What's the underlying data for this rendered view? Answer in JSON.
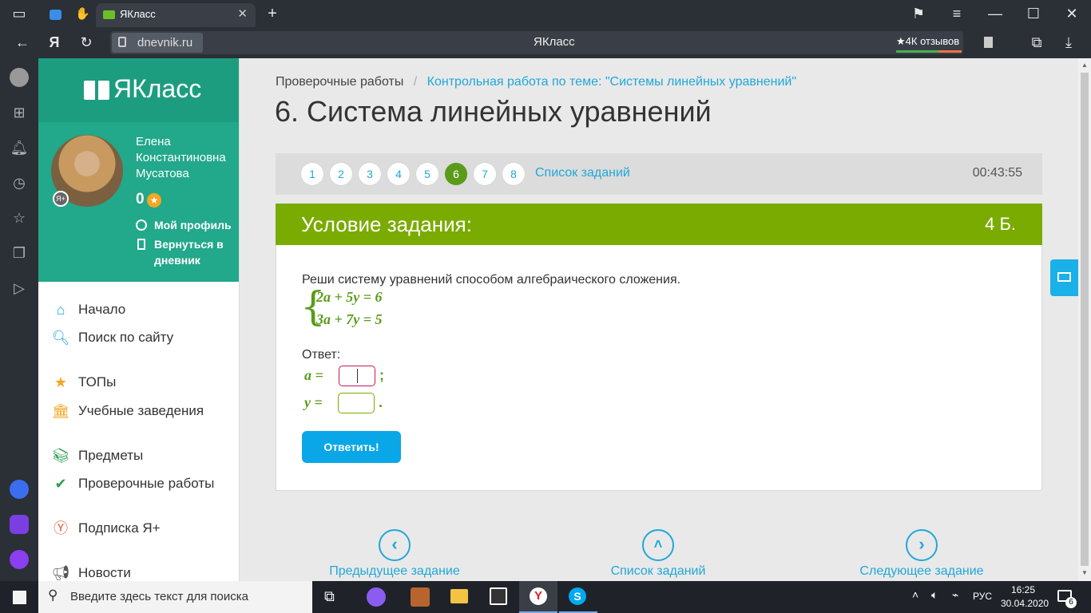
{
  "browser": {
    "tab_title": "ЯКласс",
    "address_domain": "dnevnik.ru",
    "page_title": "ЯКласс",
    "reviews_badge": "★4К отзывов",
    "yandex_letter": "Я"
  },
  "site": {
    "logo_text": "ЯКласс",
    "user": {
      "name_line1": "Елена",
      "name_line2": "Константиновна",
      "name_line3": "Мусатова",
      "points": "0",
      "my_profile": "Мой профиль",
      "back_to_diary_line1": "Вернуться в",
      "back_to_diary_line2": "дневник",
      "badge": "Я+"
    },
    "nav": [
      {
        "label": "Начало"
      },
      {
        "label": "Поиск по сайту"
      },
      {
        "label": "ТОПы"
      },
      {
        "label": "Учебные заведения"
      },
      {
        "label": "Предметы"
      },
      {
        "label": "Проверочные работы"
      },
      {
        "label": "Подписка Я+"
      },
      {
        "label": "Новости"
      }
    ]
  },
  "main": {
    "breadcrumb": {
      "root": "Проверочные работы",
      "separator": "/",
      "current": "Контрольная работа по теме: \"Системы линейных уравнений\""
    },
    "title": "6. Система линейных уравнений",
    "steps": [
      "1",
      "2",
      "3",
      "4",
      "5",
      "6",
      "7",
      "8"
    ],
    "active_step": "6",
    "task_list_link": "Список заданий",
    "timer": "00:43:55",
    "task_header": "Условие задания:",
    "points": "4 Б.",
    "task_text": "Реши систему уравнений способом алгебраического сложения.",
    "equation1": "2a + 5y = 6",
    "equation2": "3a + 7y = 5",
    "answer_label": "Ответ:",
    "var_a": "a =",
    "var_y": "y =",
    "punct_a": ";",
    "punct_y": ".",
    "submit_label": "Ответить!",
    "nav_prev": "Предыдущее задание",
    "nav_list": "Список заданий",
    "nav_next": "Следующее задание"
  },
  "taskbar": {
    "search_placeholder": "Введите здесь текст для поиска",
    "lang": "РУС",
    "time": "16:25",
    "date": "30.04.2020",
    "notifications": "6"
  },
  "colors": {
    "accent_green": "#7aab00",
    "link_blue": "#20a8d8",
    "brand_teal": "#22a88a",
    "button_blue": "#0aa7e8"
  }
}
